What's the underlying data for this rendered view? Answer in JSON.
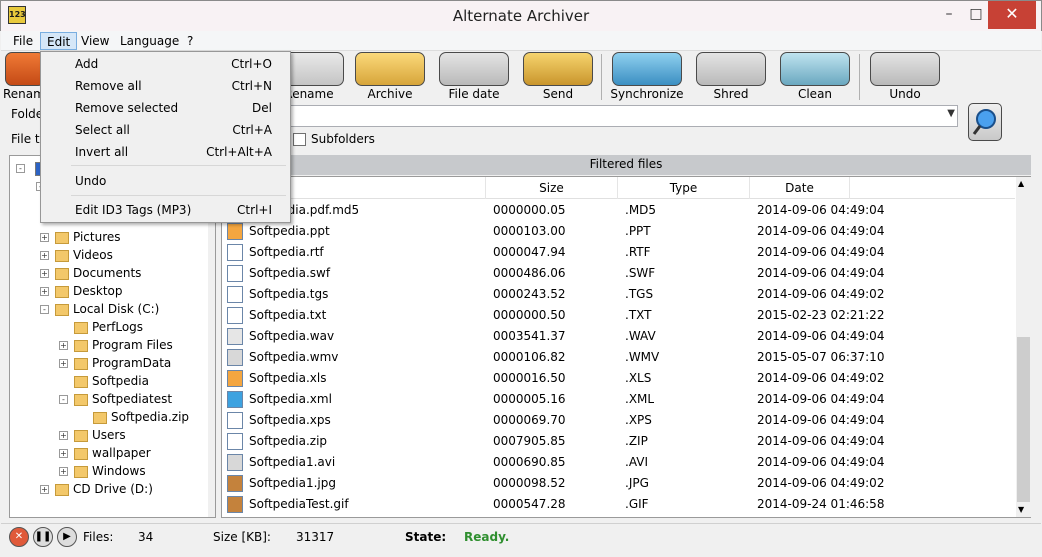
{
  "window": {
    "title": "Alternate Archiver",
    "icon_label": "123"
  },
  "menu": [
    "File",
    "Edit",
    "View",
    "Language",
    "?"
  ],
  "toolbar": [
    {
      "label": "Rename",
      "icon": "rename-icon"
    },
    {
      "label": "Rename",
      "icon": "rename-numbers-icon"
    },
    {
      "label": "Archive",
      "icon": "archive-icon"
    },
    {
      "label": "File date",
      "icon": "calendar-clock-icon"
    },
    {
      "label": "Send",
      "icon": "mail-users-icon"
    },
    {
      "label": "Synchronize",
      "icon": "sync-folders-icon"
    },
    {
      "label": "Shred",
      "icon": "shred-icon"
    },
    {
      "label": "Clean",
      "icon": "broom-monitor-icon"
    },
    {
      "label": "Undo",
      "icon": "undo-folder-icon"
    }
  ],
  "filter": {
    "folder_label": "Folde",
    "filetype_label": "File ty",
    "subfolders_label": "Subfolders",
    "subfolders_checked": false
  },
  "edit_menu": [
    {
      "label": "Add",
      "shortcut": "Ctrl+O"
    },
    {
      "label": "Remove all",
      "shortcut": "Ctrl+N"
    },
    {
      "label": "Remove selected",
      "shortcut": "Del"
    },
    {
      "label": "Select all",
      "shortcut": "Ctrl+A"
    },
    {
      "label": "Invert all",
      "shortcut": "Ctrl+Alt+A"
    },
    {
      "label": "Undo",
      "shortcut": ""
    },
    {
      "label": "Edit ID3 Tags (MP3)",
      "shortcut": "Ctrl+I"
    }
  ],
  "tree": [
    {
      "label": "Pictures",
      "indent": 1,
      "expand": "+"
    },
    {
      "label": "Videos",
      "indent": 1,
      "expand": "+"
    },
    {
      "label": "Documents",
      "indent": 1,
      "expand": "+"
    },
    {
      "label": "Desktop",
      "indent": 1,
      "expand": "+"
    },
    {
      "label": "Local Disk (C:)",
      "indent": 1,
      "expand": "-"
    },
    {
      "label": "PerfLogs",
      "indent": 2,
      "expand": ""
    },
    {
      "label": "Program Files",
      "indent": 2,
      "expand": "+"
    },
    {
      "label": "ProgramData",
      "indent": 2,
      "expand": "+"
    },
    {
      "label": "Softpedia",
      "indent": 2,
      "expand": ""
    },
    {
      "label": "Softpediatest",
      "indent": 2,
      "expand": "-"
    },
    {
      "label": "Softpedia.zip",
      "indent": 3,
      "expand": ""
    },
    {
      "label": "Users",
      "indent": 2,
      "expand": "+"
    },
    {
      "label": "wallpaper",
      "indent": 2,
      "expand": "+"
    },
    {
      "label": "Windows",
      "indent": 2,
      "expand": "+"
    },
    {
      "label": "CD Drive (D:)",
      "indent": 1,
      "expand": "+"
    }
  ],
  "list": {
    "title": "Filtered files",
    "columns": [
      "Size",
      "Type",
      "Date"
    ],
    "rows": [
      {
        "name": "Softpedia.pdf.md5",
        "size": "0000000.05",
        "type": ".MD5",
        "date": "2014-09-06 04:49:04",
        "icon": "doc"
      },
      {
        "name": "Softpedia.ppt",
        "size": "0000103.00",
        "type": ".PPT",
        "date": "2014-09-06 04:49:04",
        "icon": "orange"
      },
      {
        "name": "Softpedia.rtf",
        "size": "0000047.94",
        "type": ".RTF",
        "date": "2014-09-06 04:49:04",
        "icon": "doc"
      },
      {
        "name": "Softpedia.swf",
        "size": "0000486.06",
        "type": ".SWF",
        "date": "2014-09-06 04:49:04",
        "icon": "doc"
      },
      {
        "name": "Softpedia.tgs",
        "size": "0000243.52",
        "type": ".TGS",
        "date": "2014-09-06 04:49:02",
        "icon": "doc"
      },
      {
        "name": "Softpedia.txt",
        "size": "0000000.50",
        "type": ".TXT",
        "date": "2015-02-23 02:21:22",
        "icon": "doc"
      },
      {
        "name": "Softpedia.wav",
        "size": "0003541.37",
        "type": ".WAV",
        "date": "2014-09-06 04:49:04",
        "icon": "audio"
      },
      {
        "name": "Softpedia.wmv",
        "size": "0000106.82",
        "type": ".WMV",
        "date": "2015-05-07 06:37:10",
        "icon": "media"
      },
      {
        "name": "Softpedia.xls",
        "size": "0000016.50",
        "type": ".XLS",
        "date": "2014-09-06 04:49:02",
        "icon": "orange"
      },
      {
        "name": "Softpedia.xml",
        "size": "0000005.16",
        "type": ".XML",
        "date": "2014-09-06 04:49:04",
        "icon": "globe"
      },
      {
        "name": "Softpedia.xps",
        "size": "0000069.70",
        "type": ".XPS",
        "date": "2014-09-06 04:49:04",
        "icon": "doc"
      },
      {
        "name": "Softpedia.zip",
        "size": "0007905.85",
        "type": ".ZIP",
        "date": "2014-09-06 04:49:04",
        "icon": "doc"
      },
      {
        "name": "Softpedia1.avi",
        "size": "0000690.85",
        "type": ".AVI",
        "date": "2014-09-06 04:49:04",
        "icon": "media"
      },
      {
        "name": "Softpedia1.jpg",
        "size": "0000098.52",
        "type": ".JPG",
        "date": "2014-09-06 04:49:02",
        "icon": "image"
      },
      {
        "name": "SoftpediaTest.gif",
        "size": "0000547.28",
        "type": ".GIF",
        "date": "2014-09-24 01:46:58",
        "icon": "image"
      }
    ]
  },
  "status": {
    "files_label": "Files:",
    "files_value": "34",
    "size_label": "Size [KB]:",
    "size_value": "31317",
    "state_label": "State:",
    "state_value": "Ready.",
    "state_color": "#2f8f2f"
  }
}
